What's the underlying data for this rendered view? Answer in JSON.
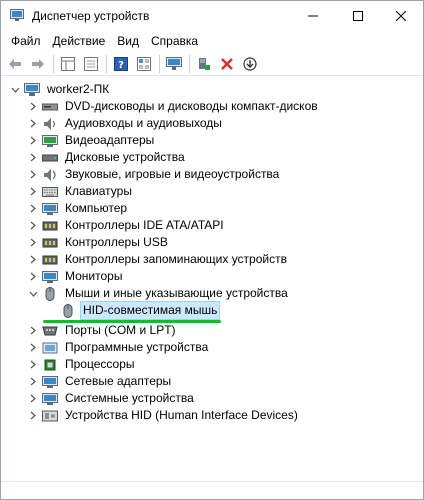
{
  "window": {
    "title": "Диспетчер устройств"
  },
  "menu": [
    "Файл",
    "Действие",
    "Вид",
    "Справка"
  ],
  "toolbar": {
    "buttons": [
      "back-arrow-icon",
      "forward-arrow-icon",
      "properties-grid-icon",
      "list-icon",
      "help-icon",
      "view-icon",
      "monitor-icon",
      "update-driver-icon",
      "remove-icon",
      "download-icon"
    ]
  },
  "tree": {
    "root": "worker2-ПК",
    "items": [
      {
        "label": "DVD-дисководы и дисководы компакт-дисков",
        "icon": "dvd-drive-icon"
      },
      {
        "label": "Аудиовходы и аудиовыходы",
        "icon": "speaker-icon"
      },
      {
        "label": "Видеоадаптеры",
        "icon": "display-adapter-icon"
      },
      {
        "label": "Дисковые устройства",
        "icon": "disk-drive-icon"
      },
      {
        "label": "Звуковые, игровые и видеоустройства",
        "icon": "sound-icon"
      },
      {
        "label": "Клавиатуры",
        "icon": "keyboard-icon"
      },
      {
        "label": "Компьютер",
        "icon": "computer-icon"
      },
      {
        "label": "Контроллеры IDE ATA/ATAPI",
        "icon": "ide-controller-icon"
      },
      {
        "label": "Контроллеры USB",
        "icon": "usb-controller-icon"
      },
      {
        "label": "Контроллеры запоминающих устройств",
        "icon": "storage-controller-icon"
      },
      {
        "label": "Мониторы",
        "icon": "monitor-icon"
      },
      {
        "label": "Мыши и иные указывающие устройства",
        "icon": "mouse-icon",
        "expanded": true,
        "children": [
          {
            "label": "HID-совместимая мышь",
            "icon": "mouse-icon",
            "selected": true
          }
        ]
      },
      {
        "label": "Порты (COM и LPT)",
        "icon": "port-icon"
      },
      {
        "label": "Программные устройства",
        "icon": "software-device-icon"
      },
      {
        "label": "Процессоры",
        "icon": "processor-icon"
      },
      {
        "label": "Сетевые адаптеры",
        "icon": "network-adapter-icon"
      },
      {
        "label": "Системные устройства",
        "icon": "system-device-icon"
      },
      {
        "label": "Устройства HID (Human Interface Devices)",
        "icon": "hid-device-icon"
      }
    ]
  }
}
